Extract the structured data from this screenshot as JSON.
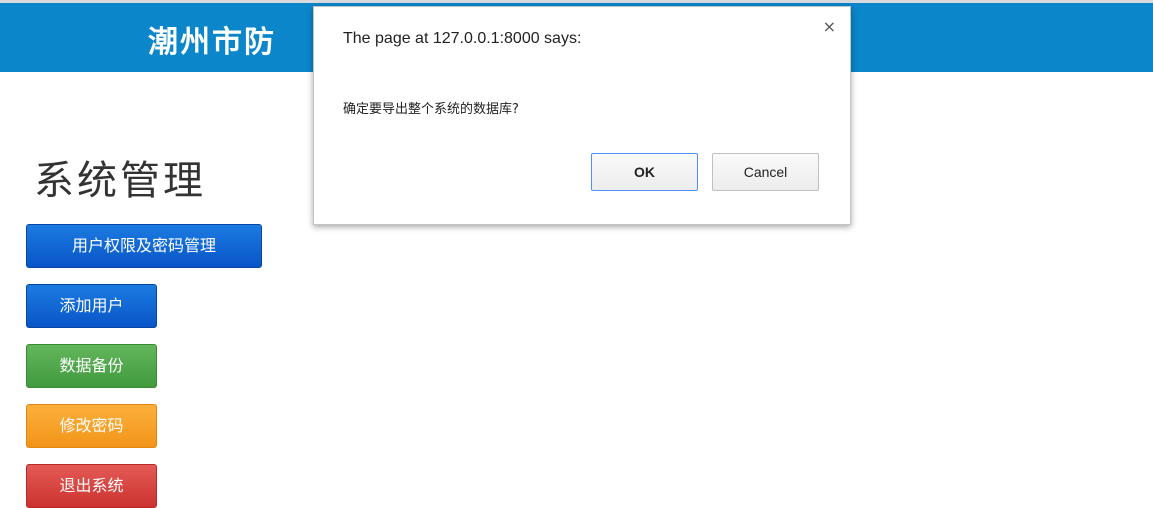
{
  "header": {
    "title": "潮州市防"
  },
  "main": {
    "section_title": "系统管理",
    "buttons": [
      {
        "label": "用户权限及密码管理",
        "color": "#0a5fd0"
      },
      {
        "label": "添加用户",
        "color": "#0a5fd0"
      },
      {
        "label": "数据备份",
        "color": "#4aa445"
      },
      {
        "label": "修改密码",
        "color": "#f6a022"
      },
      {
        "label": "退出系统",
        "color": "#d43f3a"
      }
    ]
  },
  "dialog": {
    "title": "The page at 127.0.0.1:8000 says:",
    "close_glyph": "×",
    "message": "确定要导出整个系统的数据库?",
    "ok_label": "OK",
    "cancel_label": "Cancel"
  },
  "colors": {
    "header_bg": "#0c86ca",
    "ok_border": "#4d90fe"
  }
}
